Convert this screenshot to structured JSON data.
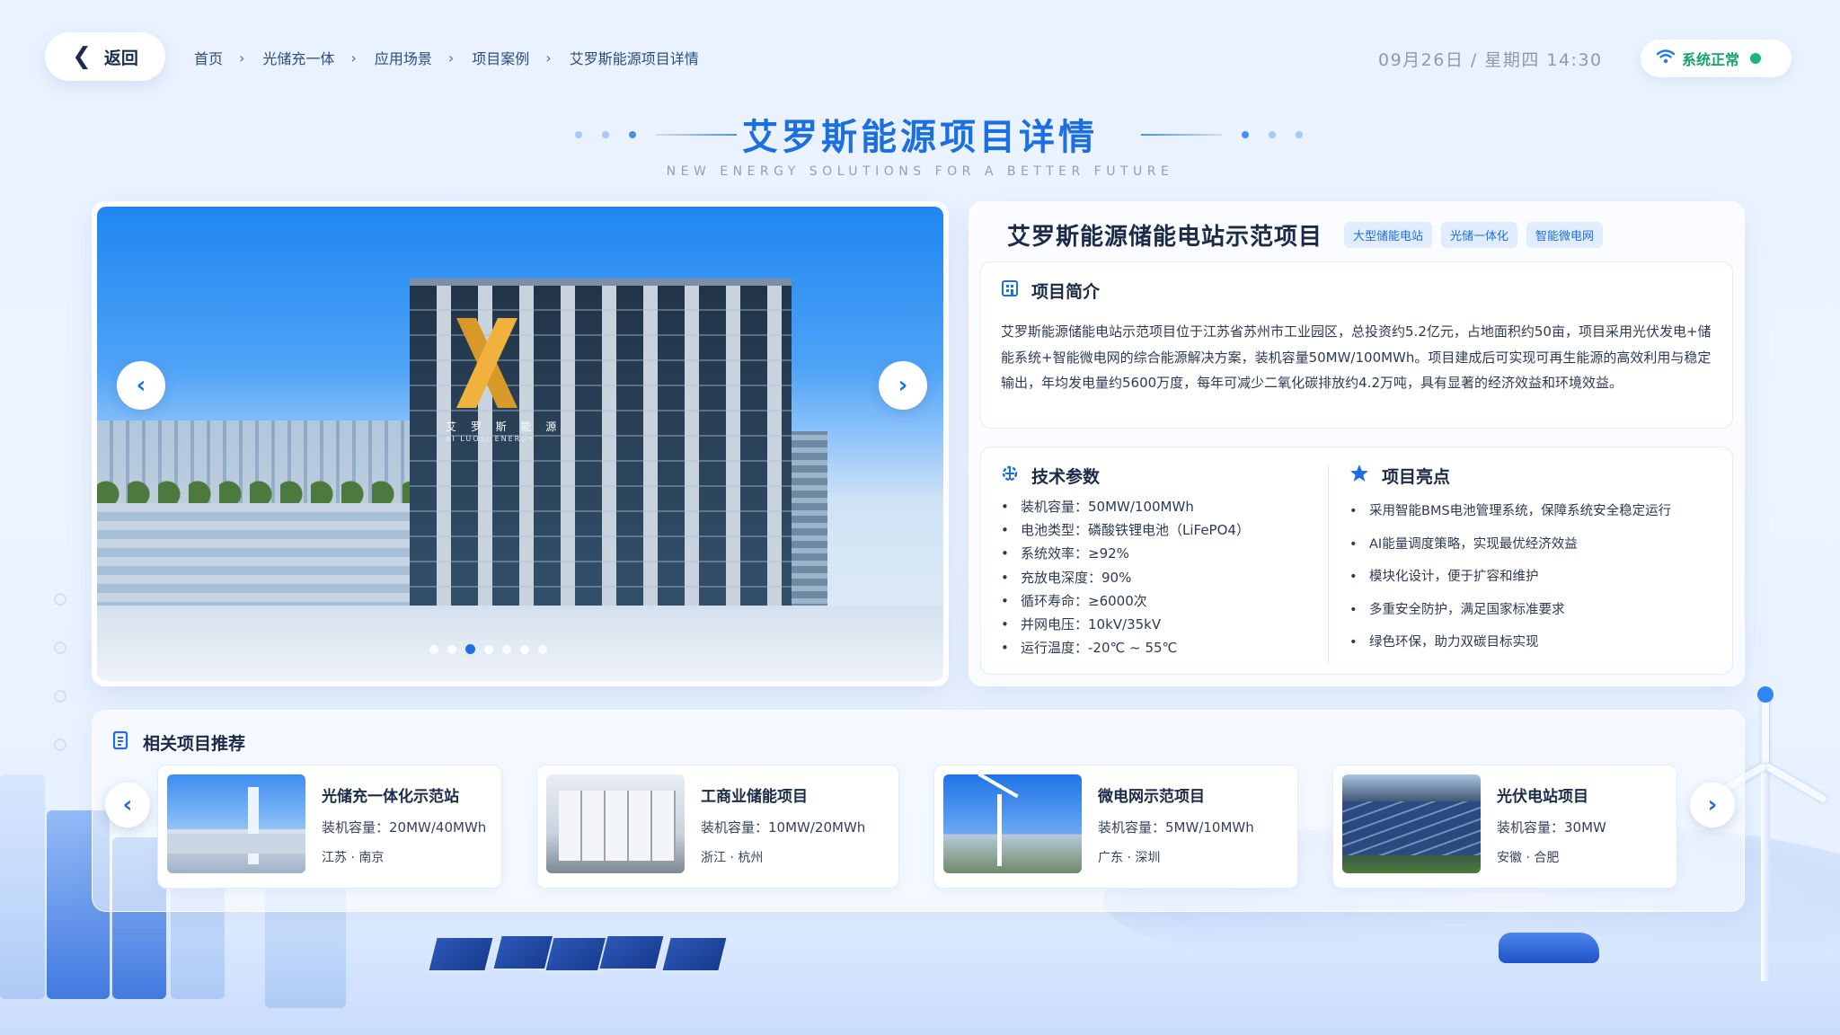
{
  "topbar": {
    "back_label": "返回",
    "breadcrumb": [
      "首页",
      "光储充一体",
      "应用场景",
      "项目案例",
      "艾罗斯能源项目详情"
    ],
    "datetime": "09月26日 / 星期四 14:30",
    "status_label": "系统正常",
    "status_color": "#17b879"
  },
  "header": {
    "title": "艾罗斯能源项目详情",
    "subtitle": "NEW ENERGY SOLUTIONS FOR A BETTER FUTURE"
  },
  "gallery": {
    "logo_text": "艾 罗 斯 能 源",
    "logo_sub": "AI  LUOSI ENERGY",
    "slide_count": 7,
    "active_slide": 3
  },
  "detail": {
    "title": "艾罗斯能源储能电站示范项目",
    "tags": [
      "大型储能电站",
      "光储一体化",
      "智能微电网"
    ],
    "intro": {
      "heading": "项目简介",
      "text": "艾罗斯能源储能电站示范项目位于江苏省苏州市工业园区，总投资约5.2亿元，占地面积约50亩，项目采用光伏发电+储能系统+智能微电网的综合能源解决方案，装机容量50MW/100MWh。项目建成后可实现可再生能源的高效利用与稳定输出，年均发电量约5600万度，每年可减少二氧化碳排放约4.2万吨，具有显著的经济效益和环境效益。"
    },
    "params": {
      "heading": "技术参数",
      "items": [
        "装机容量：50MW/100MWh",
        "电池类型：磷酸铁锂电池（LiFePO4）",
        "系统效率：≥92%",
        "充放电深度：90%",
        "循环寿命：≥6000次",
        "并网电压：10kV/35kV",
        "运行温度：-20℃ ~ 55℃"
      ]
    },
    "highlights": {
      "heading": "项目亮点",
      "items": [
        "采用智能BMS电池管理系统，保障系统安全稳定运行",
        "AI能量调度策略，实现最优经济效益",
        "模块化设计，便于扩容和维护",
        "多重安全防护，满足国家标准要求",
        "绿色环保，助力双碳目标实现"
      ]
    }
  },
  "related": {
    "heading": "相关项目推荐",
    "items": [
      {
        "title": "光储充一体化示范站",
        "capacity": "装机容量：20MW/40MWh",
        "location": "江苏 · 南京"
      },
      {
        "title": "工商业储能项目",
        "capacity": "装机容量：10MW/20MWh",
        "location": "浙江 · 杭州"
      },
      {
        "title": "微电网示范项目",
        "capacity": "装机容量：5MW/10MWh",
        "location": "广东 · 深圳"
      },
      {
        "title": "光伏电站项目",
        "capacity": "装机容量：30MW",
        "location": "安徽 · 合肥"
      }
    ]
  },
  "icons": {
    "back": "chevron-left-icon",
    "wifi": "wifi-icon",
    "intro": "building-icon",
    "params": "settings-icon",
    "highlights": "star-icon",
    "related": "document-icon"
  },
  "colors": {
    "accent": "#1c6fe0",
    "background": "#edf4ff"
  }
}
